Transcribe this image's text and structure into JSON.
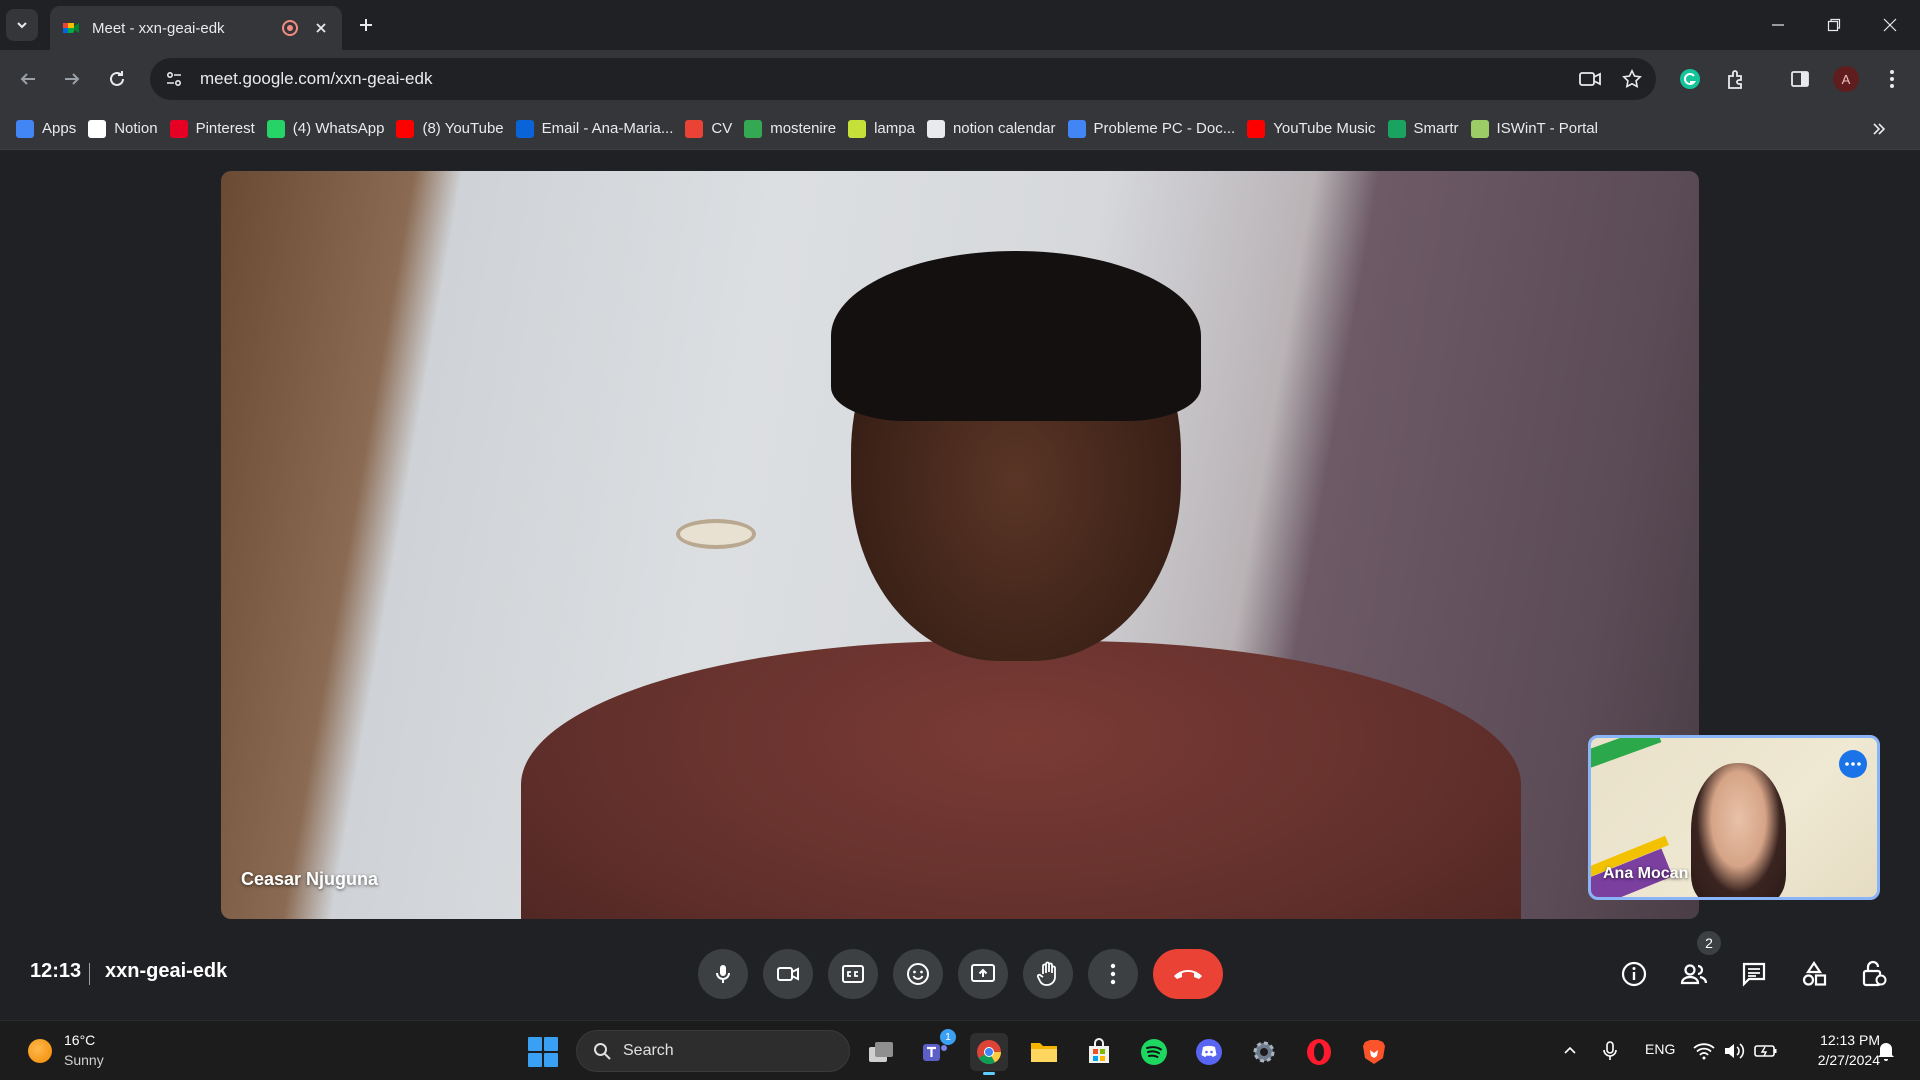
{
  "browser": {
    "tab": {
      "title": "Meet - xxn-geai-edk"
    },
    "url": "meet.google.com/xxn-geai-edk",
    "profile_initial": "A",
    "bookmarks": [
      {
        "label": "Apps",
        "icon": "apps-grid-icon",
        "color": "#4285f4"
      },
      {
        "label": "Notion",
        "icon": "notion-icon",
        "color": "#ffffff"
      },
      {
        "label": "Pinterest",
        "icon": "pinterest-icon",
        "color": "#e60023"
      },
      {
        "label": "(4) WhatsApp",
        "icon": "whatsapp-icon",
        "color": "#25d366"
      },
      {
        "label": "(8) YouTube",
        "icon": "youtube-icon",
        "color": "#ff0000"
      },
      {
        "label": "Email - Ana-Maria...",
        "icon": "outlook-icon",
        "color": "#0a64d8"
      },
      {
        "label": "CV",
        "icon": "cv-icon",
        "color": "#ea4335"
      },
      {
        "label": "mostenire",
        "icon": "google-drive-icon",
        "color": "#34a853"
      },
      {
        "label": "lampa",
        "icon": "lampa-icon",
        "color": "#c6e03a"
      },
      {
        "label": "notion calendar",
        "icon": "calendar-icon",
        "color": "#e8eaed"
      },
      {
        "label": "Probleme PC - Doc...",
        "icon": "google-docs-icon",
        "color": "#4285f4"
      },
      {
        "label": "YouTube Music",
        "icon": "youtube-music-icon",
        "color": "#ff0000"
      },
      {
        "label": "Smartr",
        "icon": "smartr-icon",
        "color": "#1aa260"
      },
      {
        "label": "ISWinT - Portal",
        "icon": "iswint-icon",
        "color": "#9ccc65"
      }
    ]
  },
  "meet": {
    "main_participant": "Ceasar Njuguna",
    "self_participant": "Ana Mocan",
    "time": "12:13",
    "meeting_code": "xxn-geai-edk",
    "people_count": "2"
  },
  "taskbar": {
    "weather": {
      "temp": "16°C",
      "desc": "Sunny"
    },
    "search_label": "Search",
    "teams_badge": "1",
    "language": "ENG",
    "clock_time": "12:13 PM",
    "clock_date": "2/27/2024"
  },
  "colors": {
    "end_call": "#ea4335",
    "self_tile_border": "#8ab4f8",
    "accent": "#1a73e8"
  }
}
